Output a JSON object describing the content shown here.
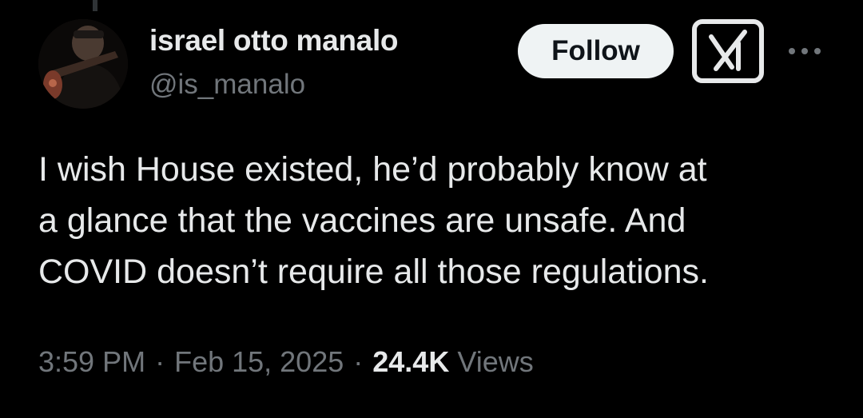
{
  "author": {
    "display_name": "israel otto manalo",
    "handle": "@is_manalo",
    "avatar_icon": "profile-photo"
  },
  "actions": {
    "follow_label": "Follow",
    "grok_icon": "grok-icon",
    "more_icon": "more-horizontal-icon"
  },
  "tweet": {
    "lines": [
      "I wish House existed, he’d probably know at",
      "a glance that the vaccines are unsafe. And",
      "COVID doesn’t require all those regulations."
    ]
  },
  "meta": {
    "time": "3:59 PM",
    "separator": "·",
    "date": "Feb 15, 2025",
    "views_count": "24.4K",
    "views_label": "Views"
  },
  "colors": {
    "background": "#000000",
    "primary_text": "#e7e9ea",
    "secondary_text": "#71767b",
    "follow_bg": "#eff3f4",
    "follow_text": "#0f1419"
  }
}
